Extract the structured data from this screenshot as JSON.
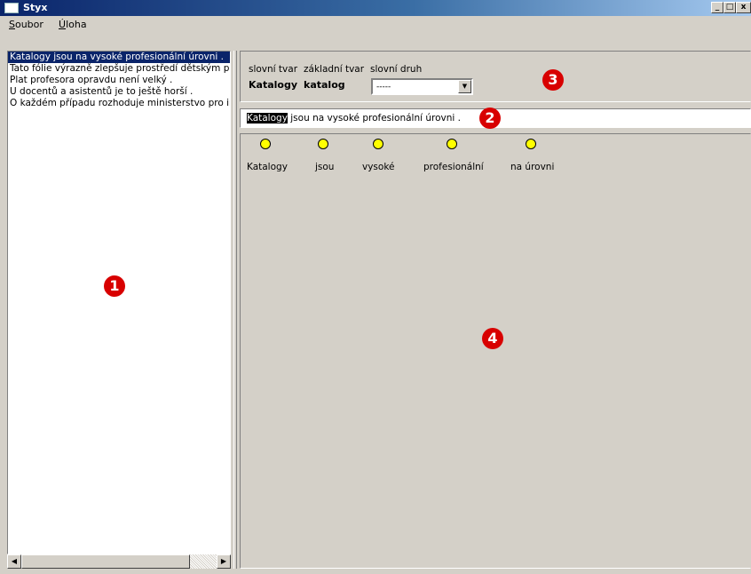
{
  "window": {
    "title": "Styx"
  },
  "window_controls": {
    "minimize": "_",
    "maximize": "□",
    "close": "x"
  },
  "menu": [
    {
      "label": "Soubor"
    },
    {
      "label": "Úloha"
    }
  ],
  "sentences": [
    {
      "text": "Katalogy jsou na vysoké profesionální úrovni .",
      "selected": true
    },
    {
      "text": "Tato fólie výrazně zlepšuje prostředí dětským pa",
      "selected": false
    },
    {
      "text": "Plat profesora opravdu není velký .",
      "selected": false
    },
    {
      "text": "U docentů a asistentů je to ještě horší .",
      "selected": false
    },
    {
      "text": "O každém případu rozhoduje ministerstvo pro im",
      "selected": false
    }
  ],
  "scrollbar": {
    "left_arrow": "◀",
    "right_arrow": "▶"
  },
  "word_info": {
    "form_label": "slovní tvar",
    "lemma_label": "základní tvar",
    "pos_label": "slovní druh",
    "form_value": "Katalogy",
    "lemma_value": "katalog",
    "pos_selected": "-----",
    "dropdown_arrow": "▼"
  },
  "current_sentence": {
    "highlighted": "Katalogy",
    "rest": " jsou na vysoké profesionální úrovni ."
  },
  "tree_nodes": [
    {
      "label": "Katalogy",
      "icon": "yellow-circle"
    },
    {
      "label": "jsou",
      "icon": "yellow-circle"
    },
    {
      "label": "vysoké",
      "icon": "yellow-circle"
    },
    {
      "label": "profesionální",
      "icon": "yellow-circle"
    },
    {
      "label": "na úrovni",
      "icon": "yellow-circle"
    }
  ],
  "badges": [
    "1",
    "2",
    "3",
    "4"
  ],
  "colors": {
    "node_fill": "#ffff00",
    "badge": "#d80000",
    "selection": "#0a246a"
  }
}
